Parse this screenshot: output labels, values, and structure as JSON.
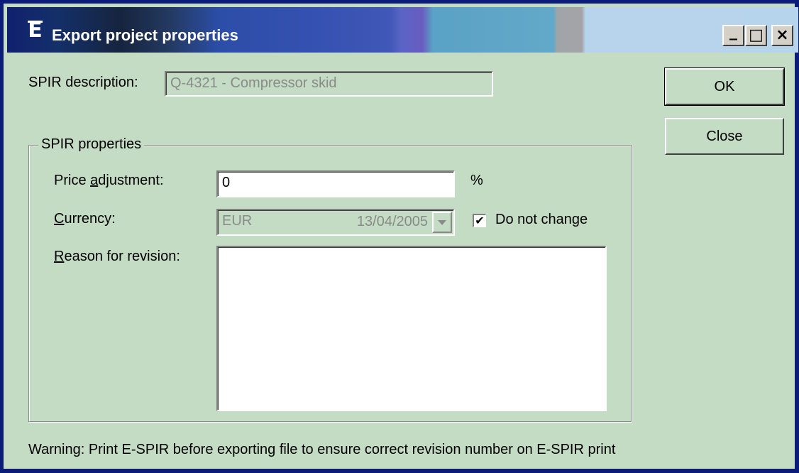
{
  "window": {
    "title": "Export project properties",
    "app_icon_letter": "E",
    "controls": {
      "minimize": "_",
      "maximize": "□",
      "close": "×"
    }
  },
  "spir_description": {
    "label": "SPIR description:",
    "value": "Q-4321 - Compressor skid"
  },
  "buttons": {
    "ok": "OK",
    "close": "Close"
  },
  "group": {
    "title": "SPIR properties",
    "price_adjustment": {
      "label_pre": "Price ",
      "label_accel": "a",
      "label_post": "djustment:",
      "value": "0",
      "unit": "%"
    },
    "currency": {
      "label_accel": "C",
      "label_post": "urrency:",
      "code": "EUR",
      "date": "13/04/2005"
    },
    "do_not_change": {
      "label": "Do not change",
      "checked": "✔"
    },
    "reason": {
      "label_accel": "R",
      "label_post": "eason for revision:",
      "value": ""
    }
  },
  "warning": "Warning: Print E-SPIR before exporting file to ensure correct revision number on E-SPIR print"
}
